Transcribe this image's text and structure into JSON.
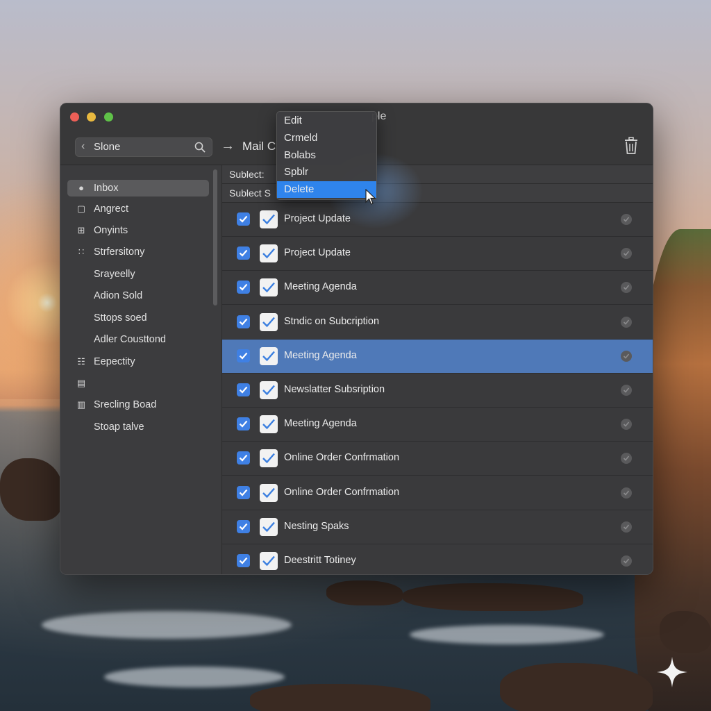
{
  "window": {
    "title_fragment": "ple",
    "search": {
      "value": "Slone"
    },
    "mail_title": "Mail C"
  },
  "sidebar": {
    "items": [
      {
        "label": "Inbox",
        "icon": "apple-icon",
        "active": true
      },
      {
        "label": "Angrect",
        "icon": "edit-box-icon"
      },
      {
        "label": "Onyints",
        "icon": "grid-plus-icon"
      },
      {
        "label": "Strfersitony",
        "icon": "people-icon"
      },
      {
        "label": "Srayeelly",
        "icon": ""
      },
      {
        "label": "Adion Sold",
        "icon": ""
      },
      {
        "label": "Sttops soed",
        "icon": ""
      },
      {
        "label": "Adler Cousttond",
        "icon": ""
      },
      {
        "label": "Eepectity",
        "icon": "grid-icon"
      },
      {
        "label": "",
        "icon": "note-icon"
      },
      {
        "label": "Srecling Boad",
        "icon": "document-icon"
      },
      {
        "label": "Stoap talve",
        "icon": ""
      }
    ]
  },
  "list": {
    "headers": [
      "Sublect:",
      "Sublect S"
    ],
    "rows": [
      {
        "subject": "Project Update"
      },
      {
        "subject": "Project Update"
      },
      {
        "subject": "Meeting Agenda"
      },
      {
        "subject": "Stndic on Subcription"
      },
      {
        "subject": "Meeting Agenda",
        "selected": true
      },
      {
        "subject": "Newslatter Subsription"
      },
      {
        "subject": "Meeting Agenda"
      },
      {
        "subject": "Online Order Confrmation"
      },
      {
        "subject": "Online Order Confrmation"
      },
      {
        "subject": "Nesting Spaks"
      },
      {
        "subject": "Deestritt Totiney"
      }
    ]
  },
  "context_menu": {
    "items": [
      "Edit",
      "Crmeld",
      "Bolabs",
      "Spblr",
      "Delete"
    ],
    "highlighted": "Delete"
  },
  "colors": {
    "accent": "#2f84ec",
    "selection": "#4f79b8",
    "checkbox": "#3f80e4"
  }
}
